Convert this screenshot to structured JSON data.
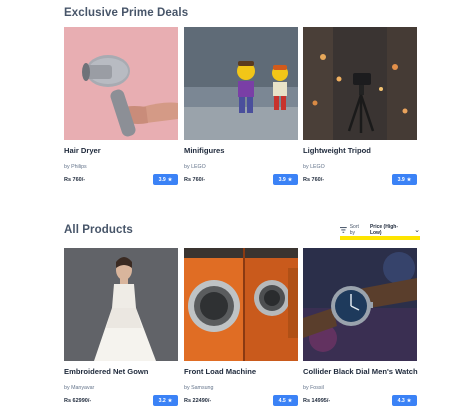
{
  "sections": {
    "prime_title": "Exclusive Prime Deals",
    "all_title": "All Products"
  },
  "sort": {
    "label": "Sort by",
    "value": "Price (High-Low)"
  },
  "prime_products": [
    {
      "name": "Hair Dryer",
      "brand": "by Philips",
      "price": "Rs 760/-",
      "rating": "3.9"
    },
    {
      "name": "Minifigures",
      "brand": "by LEGO",
      "price": "Rs 760/-",
      "rating": "3.9"
    },
    {
      "name": "Lightweight Tripod",
      "brand": "by LEGO",
      "price": "Rs 760/-",
      "rating": "3.9"
    }
  ],
  "all_products": [
    {
      "name": "Embroidered Net Gown",
      "brand": "by Manyavar",
      "price": "Rs 62990/-",
      "rating": "3.2"
    },
    {
      "name": "Front Load Machine",
      "brand": "by Samsung",
      "price": "Rs 22490/-",
      "rating": "4.5"
    },
    {
      "name": "Collider Black Dial Men's Watch",
      "brand": "by Fossil",
      "price": "Rs 14995/-",
      "rating": "4.3"
    }
  ],
  "icons": {
    "star": "star-icon",
    "sort": "sort-icon",
    "chevron": "chevron-down-icon"
  },
  "colors": {
    "accent": "#3b82f6",
    "highlight": "#fde400",
    "heading": "#475569"
  }
}
